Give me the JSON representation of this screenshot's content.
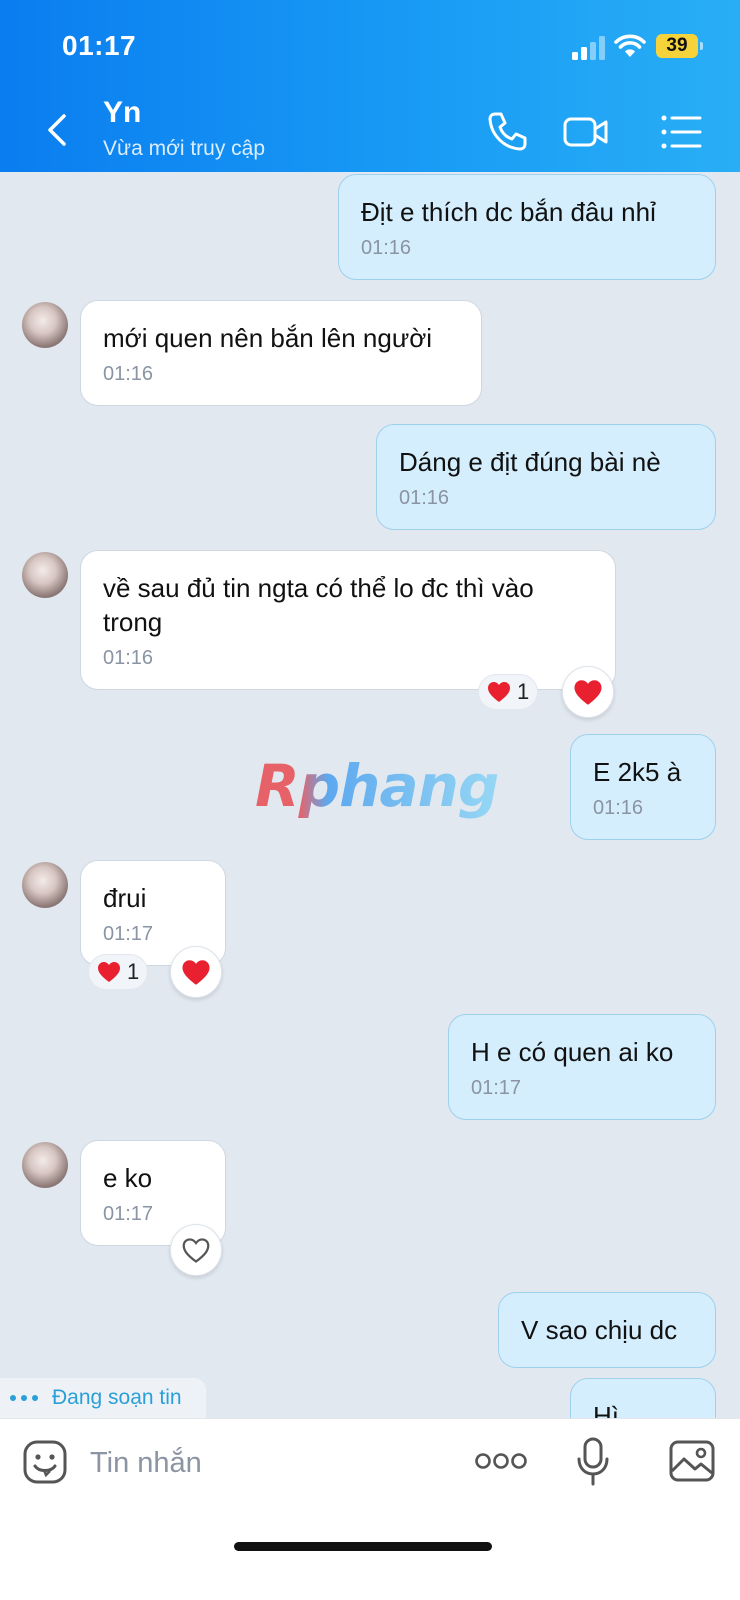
{
  "status_bar": {
    "time": "01:17",
    "battery": "39"
  },
  "header": {
    "name": "Yn",
    "status": "Vừa mới truy cập"
  },
  "messages": [
    {
      "text": "Địt e thích dc bắn đâu nhỉ",
      "time": "01:16"
    },
    {
      "text": "mới quen nên bắn lên người",
      "time": "01:16"
    },
    {
      "text": "Dáng e địt đúng bài nè",
      "time": "01:16"
    },
    {
      "text": "về sau đủ tin ngta có thể lo đc thì vào\ntrong",
      "time": "01:16",
      "reaction_count": "1"
    },
    {
      "text": "E 2k5 à",
      "time": "01:16"
    },
    {
      "text": "đrui",
      "time": "01:17",
      "reaction_count": "1"
    },
    {
      "text": "H e có quen ai ko",
      "time": "01:17"
    },
    {
      "text": "e ko",
      "time": "01:17"
    },
    {
      "text": "V sao chịu dc"
    },
    {
      "text": "Hì"
    }
  ],
  "watermark": "Rphang",
  "typing": {
    "label": "Đang soạn tin"
  },
  "input": {
    "placeholder": "Tin nhắn"
  }
}
